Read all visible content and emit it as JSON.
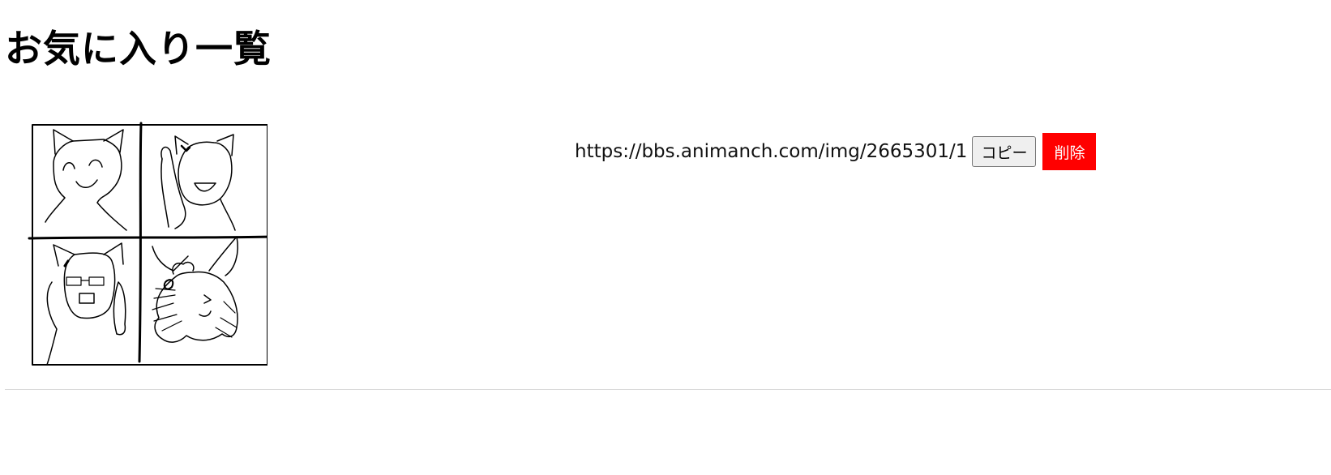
{
  "page": {
    "title": "お気に入り一覧"
  },
  "favorites": [
    {
      "url": "https://bbs.animanch.com/img/2665301/1",
      "copy_label": "コピー",
      "delete_label": "削除"
    }
  ],
  "colors": {
    "delete_button_bg": "#ff0000",
    "delete_button_text": "#ffffff",
    "copy_button_bg": "#efefef",
    "divider": "#d9d9d9"
  }
}
